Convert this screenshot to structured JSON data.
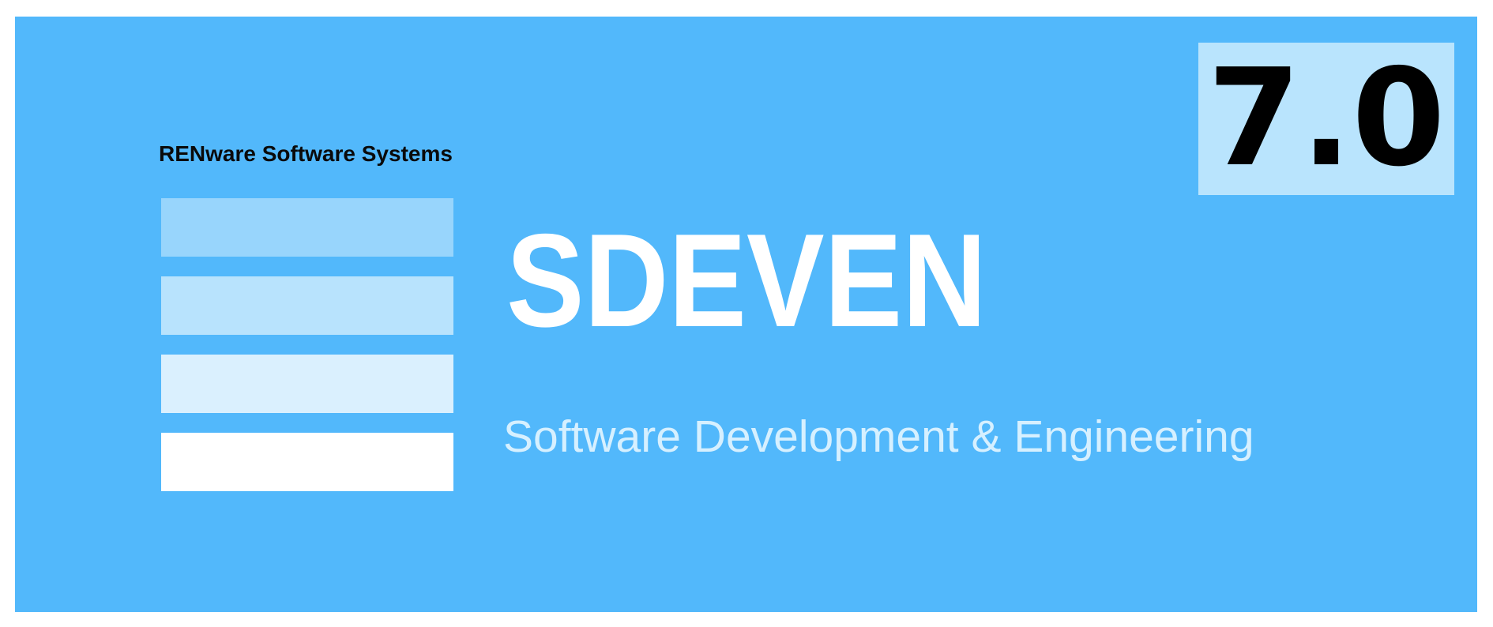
{
  "splash": {
    "company": "RENware Software Systems",
    "product_name": "SDEVEN",
    "tagline": "Software Development & Engineering",
    "version": "7.0",
    "logo": {
      "icon": "stacked-stripes-logo-icon",
      "stripe_colors": [
        "#98d5fc",
        "#b8e3fd",
        "#daf0fe",
        "#ffffff"
      ]
    }
  },
  "colors": {
    "background": "#52b8fb",
    "version_box": "#b9e4fd",
    "product_text": "#ffffff",
    "tagline_text": "#d6f0ff",
    "company_text": "#0a0a0a"
  }
}
